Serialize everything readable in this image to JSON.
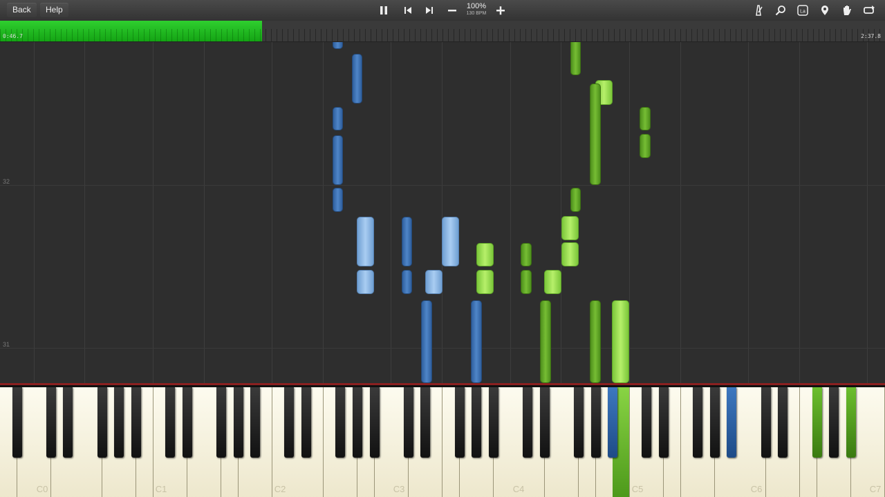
{
  "toolbar": {
    "back_label": "Back",
    "help_label": "Help",
    "speed_percent": "100%",
    "tempo": "130 BPM",
    "icons": [
      "pause-icon",
      "previous-icon",
      "next-icon",
      "speed-down-icon",
      "speed-up-icon",
      "metronome-icon",
      "zoom-icon",
      "label-icon",
      "marker-icon",
      "hand-icon",
      "loop-icon"
    ]
  },
  "progress": {
    "elapsed": "0:46.7",
    "total": "2:37.8",
    "fraction": 0.296,
    "color": "#22bb22"
  },
  "roll": {
    "measure_numbers": [
      "32",
      "31"
    ]
  },
  "piano": {
    "octave_labels": [
      "C0",
      "C1",
      "C2",
      "C3",
      "C4",
      "C5",
      "C6",
      "C7"
    ]
  },
  "colors": {
    "left_hand": "#4f86c8",
    "left_hand_light": "#a9cdf2",
    "right_hand": "#76bd34",
    "right_hand_light": "#b6f06a"
  }
}
